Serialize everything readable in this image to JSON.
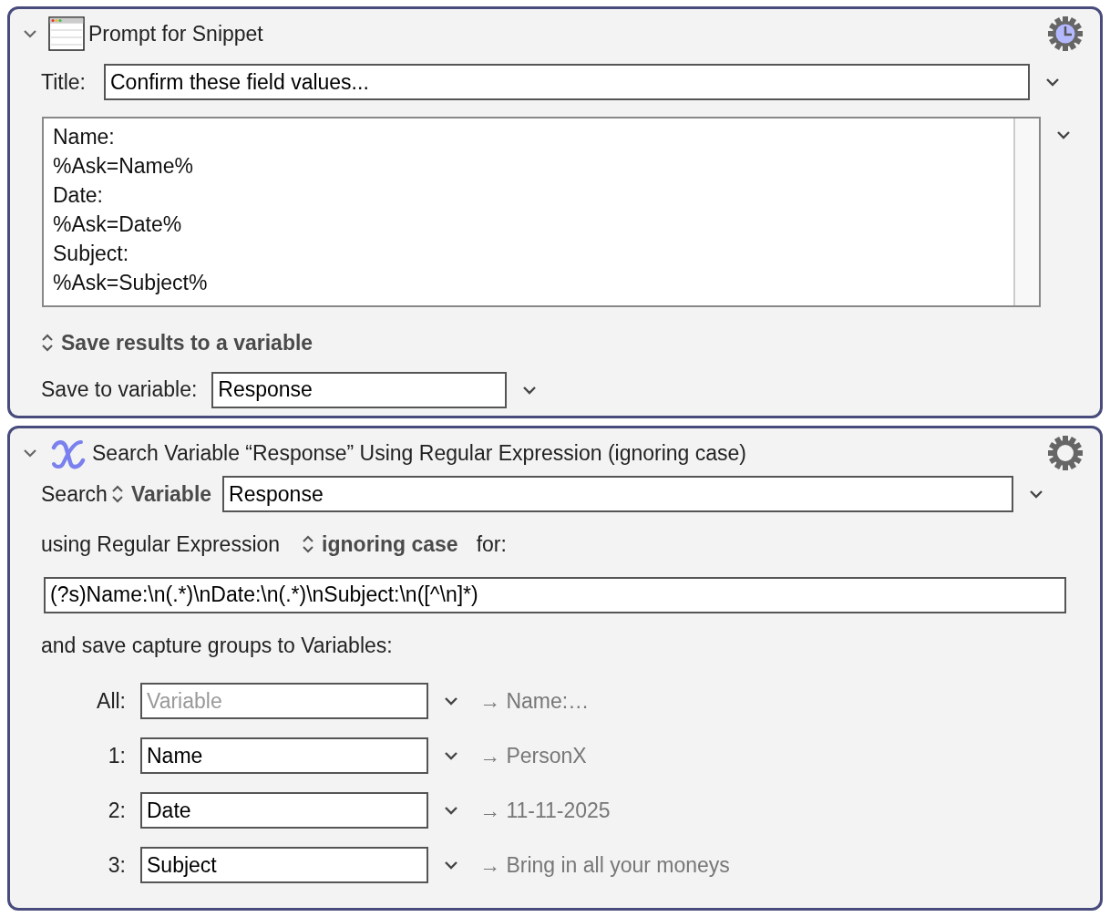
{
  "actions": [
    {
      "kind": "prompt_snippet",
      "expanded": true,
      "title": "Prompt for Snippet",
      "gear_clock": true,
      "title_field": {
        "label": "Title:",
        "value": "Confirm these field values..."
      },
      "snippet": [
        "Name:",
        "%Ask=Name%",
        "Date:",
        "%Ask=Date%",
        "Subject:",
        "%Ask=Subject%"
      ],
      "save_mode": "Save results to a variable",
      "save_field": {
        "label": "Save to variable:",
        "value": "Response"
      }
    },
    {
      "kind": "regex_search",
      "expanded": true,
      "title": "Search Variable “Response” Using Regular Expression (ignoring case)",
      "gear_clock": false,
      "source": {
        "label": "Search",
        "mode": "Variable",
        "value": "Response"
      },
      "using": "using Regular Expression",
      "case_mode": "ignoring case",
      "for": "for:",
      "pattern": "(?s)Name:\\n(.*)\\nDate:\\n(.*)\\nSubject:\\n([^\\n]*)",
      "captures_label": "and save capture groups to Variables:",
      "captures": [
        {
          "label": "All:",
          "placeholder": "Variable",
          "result": "→ Name:…"
        },
        {
          "label": "1:",
          "value": "Name",
          "result": "→ PersonX"
        },
        {
          "label": "2:",
          "value": "Date",
          "result": "→ 11-11-2025"
        },
        {
          "label": "3:",
          "value": "Subject",
          "result": "→ Bring in all your moneys"
        }
      ]
    }
  ]
}
